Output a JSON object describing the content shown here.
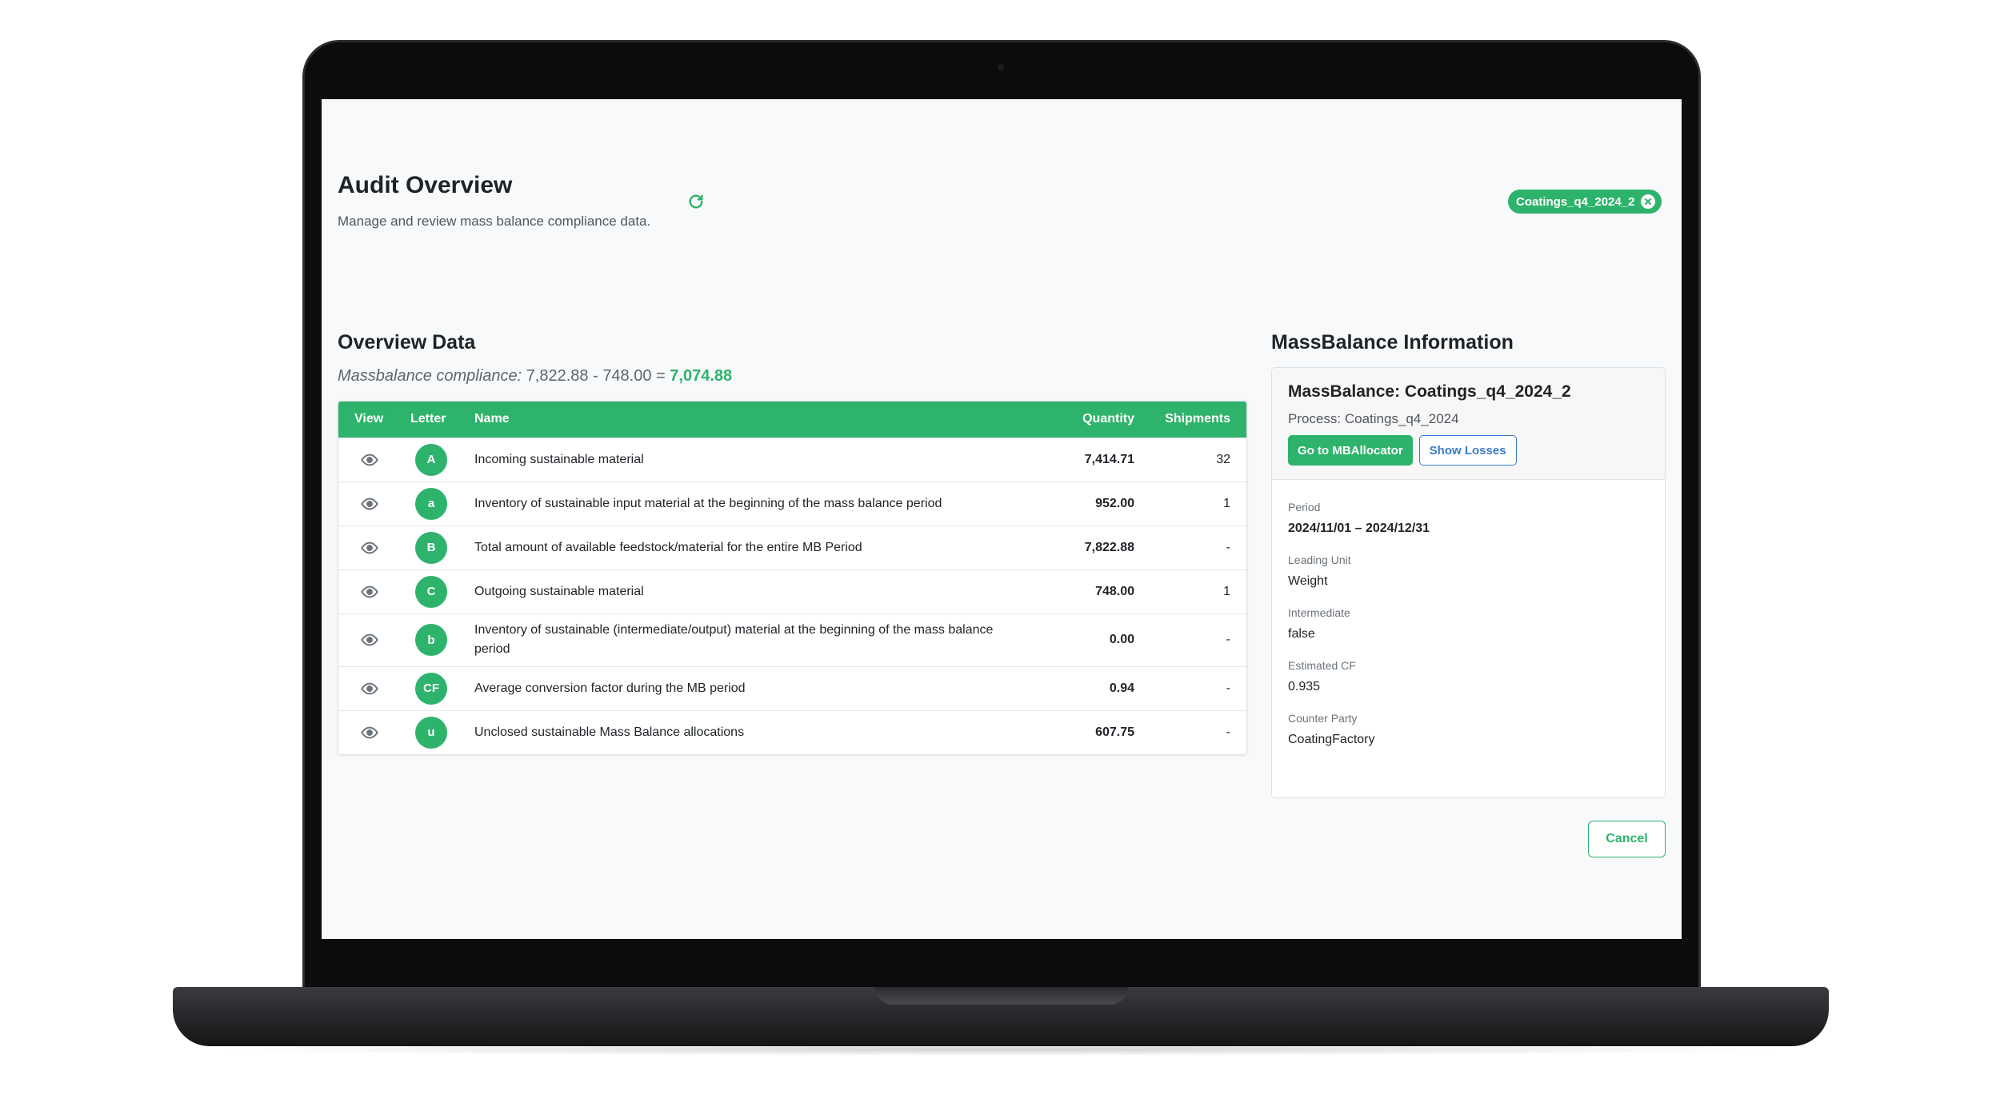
{
  "header": {
    "title": "Audit Overview",
    "subtitle": "Manage and review mass balance compliance data.",
    "refresh_icon": "refresh-icon",
    "chip": {
      "label": "Coatings_q4_2024_2",
      "close_icon": "close-circle-icon"
    }
  },
  "overview": {
    "title": "Overview Data",
    "compliance": {
      "label": "Massbalance compliance:",
      "expression": "7,822.88 - 748.00 =",
      "result": "7,074.88"
    },
    "table": {
      "columns": [
        "View",
        "Letter",
        "Name",
        "Quantity",
        "Shipments"
      ],
      "rows": [
        {
          "letter": "A",
          "name": "Incoming sustainable material",
          "quantity": "7,414.71",
          "shipments": "32"
        },
        {
          "letter": "a",
          "name": "Inventory of sustainable input material at the beginning of the mass balance period",
          "quantity": "952.00",
          "shipments": "1"
        },
        {
          "letter": "B",
          "name": "Total amount of available feedstock/material for the entire MB Period",
          "quantity": "7,822.88",
          "shipments": "-"
        },
        {
          "letter": "C",
          "name": "Outgoing sustainable material",
          "quantity": "748.00",
          "shipments": "1"
        },
        {
          "letter": "b",
          "name": "Inventory of sustainable (intermediate/output) material at the beginning of the mass balance period",
          "quantity": "0.00",
          "shipments": "-"
        },
        {
          "letter": "CF",
          "name": "Average conversion factor during the MB period",
          "quantity": "0.94",
          "shipments": "-"
        },
        {
          "letter": "u",
          "name": "Unclosed sustainable Mass Balance allocations",
          "quantity": "607.75",
          "shipments": "-"
        }
      ]
    }
  },
  "massbalance": {
    "section_title": "MassBalance Information",
    "card_title": "MassBalance: Coatings_q4_2024_2",
    "process": "Process: Coatings_q4_2024",
    "go_button": "Go to MBAllocator",
    "losses_button": "Show Losses",
    "fields": [
      {
        "label": "Period",
        "value": "2024/11/01 – 2024/12/31"
      },
      {
        "label": "Leading Unit",
        "value": "Weight"
      },
      {
        "label": "Intermediate",
        "value": "false"
      },
      {
        "label": "Estimated CF",
        "value": "0.935"
      },
      {
        "label": "Counter Party",
        "value": "CoatingFactory"
      }
    ]
  },
  "footer": {
    "cancel_label": "Cancel"
  },
  "colors": {
    "accent": "#2db36b",
    "link_blue": "#3a7bc8",
    "background": "#f8f9fa"
  }
}
